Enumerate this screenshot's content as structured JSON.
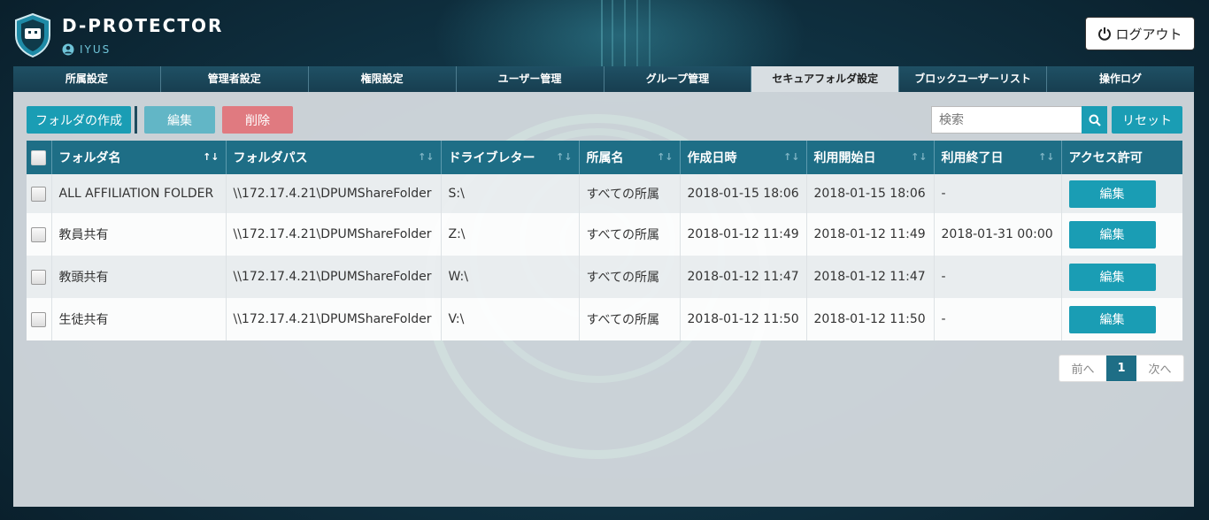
{
  "app": {
    "brand": "D-PROTECTOR",
    "user": "IYUS",
    "logout_label": "ログアウト"
  },
  "tabs": [
    {
      "label": "所属設定"
    },
    {
      "label": "管理者設定"
    },
    {
      "label": "権限設定"
    },
    {
      "label": "ユーザー管理"
    },
    {
      "label": "グループ管理"
    },
    {
      "label": "セキュアフォルダ設定"
    },
    {
      "label": "ブロックユーザーリスト"
    },
    {
      "label": "操作ログ"
    }
  ],
  "active_tab": "セキュアフォルダ設定",
  "toolbar": {
    "create_label": "フォルダの作成",
    "edit_label": "編集",
    "delete_label": "削除"
  },
  "search": {
    "placeholder": "検索",
    "reset_label": "リセット"
  },
  "table": {
    "columns": [
      "フォルダ名",
      "フォルダパス",
      "ドライブレター",
      "所属名",
      "作成日時",
      "利用開始日",
      "利用終了日",
      "アクセス許可"
    ],
    "rows": [
      {
        "name": "ALL AFFILIATION FOLDER",
        "path": "\\\\172.17.4.21\\DPUMShareFolder",
        "drive": "S:\\",
        "affiliation": "すべての所属",
        "created": "2018-01-15 18:06",
        "start": "2018-01-15 18:06",
        "end": "-",
        "action": "編集"
      },
      {
        "name": "教員共有",
        "path": "\\\\172.17.4.21\\DPUMShareFolder",
        "drive": "Z:\\",
        "affiliation": "すべての所属",
        "created": "2018-01-12 11:49",
        "start": "2018-01-12 11:49",
        "end": "2018-01-31 00:00",
        "action": "編集"
      },
      {
        "name": "教頭共有",
        "path": "\\\\172.17.4.21\\DPUMShareFolder",
        "drive": "W:\\",
        "affiliation": "すべての所属",
        "created": "2018-01-12 11:47",
        "start": "2018-01-12 11:47",
        "end": "-",
        "action": "編集"
      },
      {
        "name": "生徒共有",
        "path": "\\\\172.17.4.21\\DPUMShareFolder",
        "drive": "V:\\",
        "affiliation": "すべての所属",
        "created": "2018-01-12 11:50",
        "start": "2018-01-12 11:50",
        "end": "-",
        "action": "編集"
      }
    ]
  },
  "pagination": {
    "prev": "前へ",
    "current": "1",
    "next": "次へ"
  },
  "colors": {
    "accent": "#1a9db4",
    "header_row": "#1e6e86",
    "delete": "#e07a80",
    "nav": "#1c4a5e"
  }
}
